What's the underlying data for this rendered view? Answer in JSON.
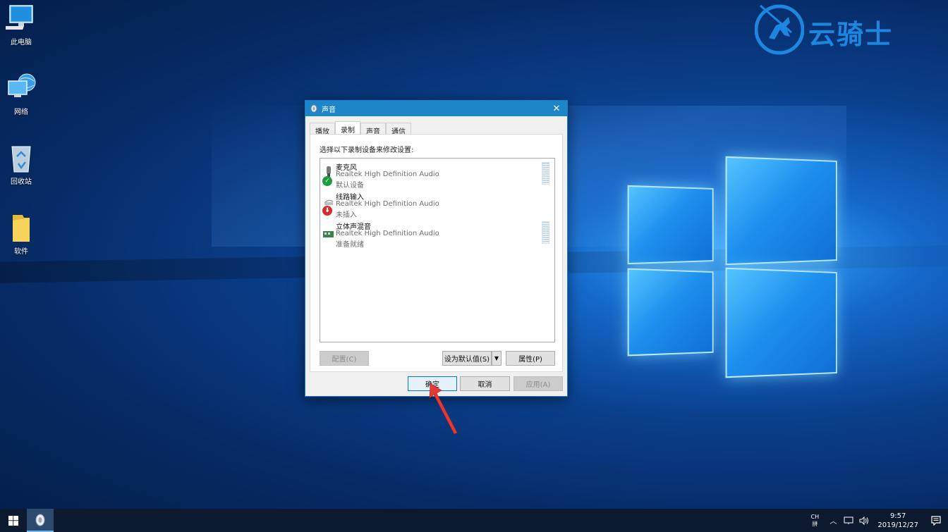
{
  "desktop": {
    "icons": [
      {
        "label": "此电脑",
        "icon": "computer-icon"
      },
      {
        "label": "网络",
        "icon": "network-icon"
      },
      {
        "label": "回收站",
        "icon": "recycle-bin-icon"
      },
      {
        "label": "软件",
        "icon": "folder-icon"
      }
    ]
  },
  "brand": {
    "text": "云骑士",
    "color": "#1c86e0"
  },
  "dialog": {
    "title": "声音",
    "close_label": "✕",
    "tabs": [
      {
        "label": "播放",
        "active": false
      },
      {
        "label": "录制",
        "active": true
      },
      {
        "label": "声音",
        "active": false
      },
      {
        "label": "通信",
        "active": false
      }
    ],
    "instruction": "选择以下录制设备来修改设置:",
    "devices": [
      {
        "name": "麦克风",
        "driver": "Realtek High Definition Audio",
        "status": "默认设备",
        "icon": "microphone-icon",
        "badge": "default-check"
      },
      {
        "name": "线路输入",
        "driver": "Realtek High Definition Audio",
        "status": "未插入",
        "icon": "line-in-icon",
        "badge": "unplugged"
      },
      {
        "name": "立体声混音",
        "driver": "Realtek High Definition Audio",
        "status": "准备就绪",
        "icon": "sound-card-icon",
        "badge": "none"
      }
    ],
    "buttons": {
      "configure": "配置(C)",
      "set_default": "设为默认值(S)",
      "properties": "属性(P)",
      "ok": "确定",
      "cancel": "取消",
      "apply": "应用(A)"
    }
  },
  "taskbar": {
    "ime_top": "CH",
    "ime_bottom": "拼",
    "time": "9:57",
    "date": "2019/12/27"
  },
  "colors": {
    "title_bar": "#1d86c8",
    "accent": "#0078d7",
    "annotation_arrow": "#e53935",
    "check_badge": "#1e9e3a",
    "unplugged_badge": "#d92b2b"
  }
}
